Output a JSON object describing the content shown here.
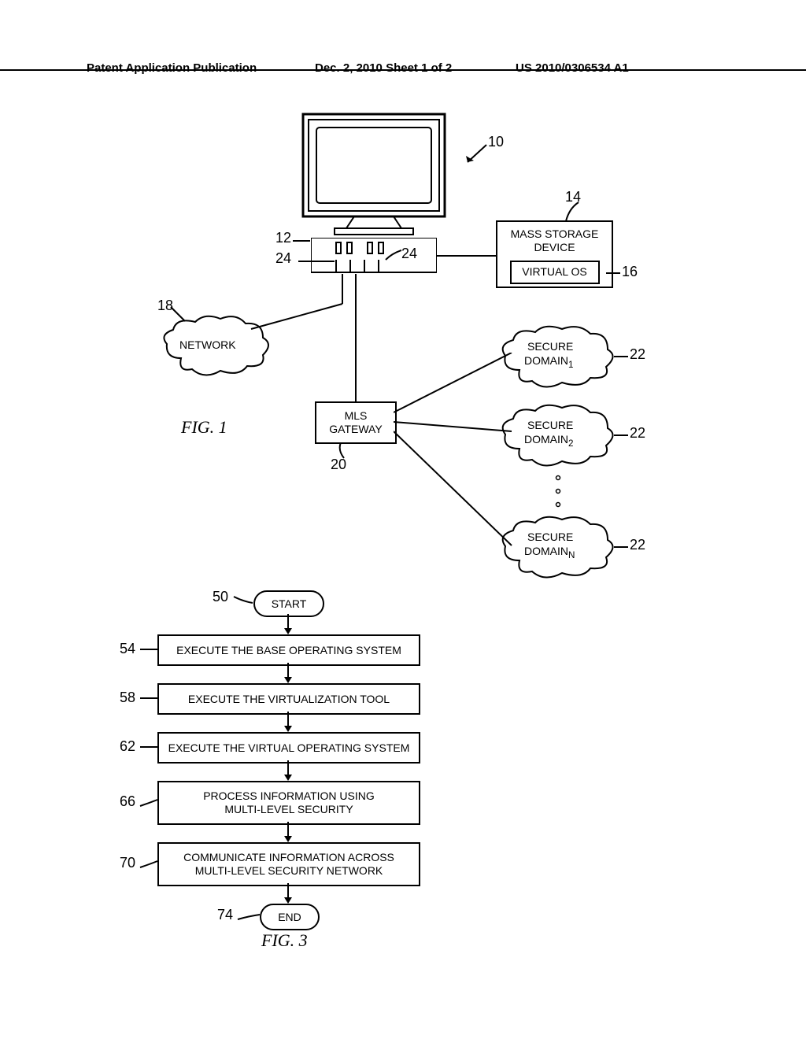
{
  "header": {
    "left": "Patent Application Publication",
    "mid": "Dec. 2, 2010  Sheet 1 of 2",
    "right": "US 2010/0306534 A1"
  },
  "fig1": {
    "label": "FIG. 1",
    "ref_system": "10",
    "ref_computer": "12",
    "ref_mass": "14",
    "ref_virtual": "16",
    "ref_network": "18",
    "ref_gateway": "20",
    "ref_domain": "22",
    "ref_port_left": "24",
    "ref_port_right": "24",
    "mass_storage": "MASS STORAGE DEVICE",
    "virtual_os": "VIRTUAL OS",
    "network": "NETWORK",
    "gateway": "MLS GATEWAY",
    "domain1_l1": "SECURE",
    "domain1_l2": "DOMAIN",
    "domain1_sub": "1",
    "domain2_l1": "SECURE",
    "domain2_l2": "DOMAIN",
    "domain2_sub": "2",
    "domainN_l1": "SECURE",
    "domainN_l2": "DOMAIN",
    "domainN_sub": "N"
  },
  "fig3": {
    "label": "FIG. 3",
    "start": "START",
    "end": "END",
    "step54": "EXECUTE THE BASE OPERATING SYSTEM",
    "step58": "EXECUTE THE VIRTUALIZATION TOOL",
    "step62": "EXECUTE THE VIRTUAL OPERATING SYSTEM",
    "step66_l1": "PROCESS INFORMATION USING",
    "step66_l2": "MULTI-LEVEL SECURITY",
    "step70_l1": "COMMUNICATE INFORMATION ACROSS",
    "step70_l2": "MULTI-LEVEL SECURITY NETWORK",
    "ref_start": "50",
    "ref_54": "54",
    "ref_58": "58",
    "ref_62": "62",
    "ref_66": "66",
    "ref_70": "70",
    "ref_end": "74"
  }
}
